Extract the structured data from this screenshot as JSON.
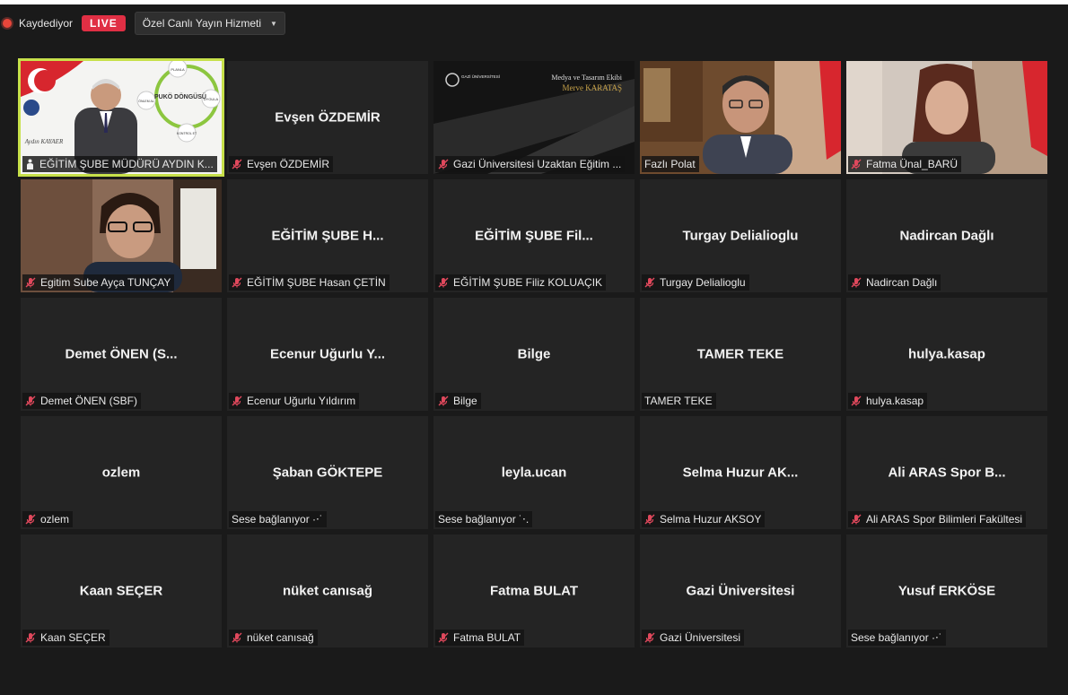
{
  "recording": {
    "label": "Kaydediyor",
    "live": "LIVE",
    "stream_service": "Özel Canlı Yayın Hizmeti"
  },
  "colors": {
    "active_border": "#c7e04a",
    "live": "#e02f44",
    "muted_mic": "#e0485c"
  },
  "tiles": [
    {
      "name": "",
      "label": "EĞİTİM ŞUBE MÜDÜRÜ AYDIN K...",
      "icon": "hand-icon",
      "active": true,
      "video": "presentation",
      "slide": {
        "center": "PUKÖ DÖNGÜSÜ",
        "planla": "PLANLA",
        "uygula": "UYGULA",
        "kontrol": "KONTROL ET",
        "onlem": "ÖNLEM AL",
        "signature": "Aydın KAYAER"
      }
    },
    {
      "name": "Evşen ÖZDEMİR",
      "label": "Evşen ÖZDEMİR",
      "icon": "mic-muted-icon"
    },
    {
      "name": "",
      "label": "Gazi Üniversitesi Uzaktan Eğitim ...",
      "icon": "mic-muted-icon",
      "video": "banner",
      "banner": {
        "org": "GAZİ ÜNİVERSİTESİ",
        "line1": "Medya ve Tasarım Ekibi",
        "line2": "Merve KARATAŞ"
      }
    },
    {
      "name": "",
      "label": "Fazlı Polat",
      "icon": "",
      "video": "man"
    },
    {
      "name": "",
      "label": "Fatma Ünal_BARÜ",
      "icon": "mic-muted-icon",
      "video": "woman"
    },
    {
      "name": "",
      "label": "Egitim Sube Ayça TUNÇAY",
      "icon": "mic-muted-icon",
      "video": "woman2"
    },
    {
      "name": "EĞİTİM ŞUBE H...",
      "label": "EĞİTİM ŞUBE Hasan ÇETİN",
      "icon": "mic-muted-icon"
    },
    {
      "name": "EĞİTİM ŞUBE Fil...",
      "label": "EĞİTİM ŞUBE Filiz KOLUAÇIK",
      "icon": "mic-muted-icon"
    },
    {
      "name": "Turgay Delialioglu",
      "label": "Turgay Delialioglu",
      "icon": "mic-muted-icon"
    },
    {
      "name": "Nadircan Dağlı",
      "label": "Nadircan Dağlı",
      "icon": "mic-muted-icon"
    },
    {
      "name": "Demet ÖNEN (S...",
      "label": "Demet ÖNEN (SBF)",
      "icon": "mic-muted-icon"
    },
    {
      "name": "Ecenur Uğurlu Y...",
      "label": "Ecenur Uğurlu Yıldırım",
      "icon": "mic-muted-icon"
    },
    {
      "name": "Bilge",
      "label": "Bilge",
      "icon": "mic-muted-icon"
    },
    {
      "name": "TAMER TEKE",
      "label": "TAMER TEKE",
      "icon": ""
    },
    {
      "name": "hulya.kasap",
      "label": "hulya.kasap",
      "icon": "mic-muted-icon"
    },
    {
      "name": "ozlem",
      "label": "ozlem",
      "icon": "mic-muted-icon"
    },
    {
      "name": "Şaban GÖKTEPE",
      "label": "Sese bağlanıyor ·⋅˙",
      "icon": ""
    },
    {
      "name": "leyla.ucan",
      "label": "Sese bağlanıyor ˙⋅.",
      "icon": ""
    },
    {
      "name": "Selma Huzur AK...",
      "label": "Selma Huzur AKSOY",
      "icon": "mic-muted-icon"
    },
    {
      "name": "Ali ARAS Spor B...",
      "label": "Ali ARAS Spor Bilimleri Fakültesi",
      "icon": "mic-muted-icon"
    },
    {
      "name": "Kaan SEÇER",
      "label": "Kaan SEÇER",
      "icon": "mic-muted-icon"
    },
    {
      "name": "nüket canısağ",
      "label": "nüket canısağ",
      "icon": "mic-muted-icon"
    },
    {
      "name": "Fatma BULAT",
      "label": "Fatma BULAT",
      "icon": "mic-muted-icon"
    },
    {
      "name": "Gazi Üniversitesi",
      "label": "Gazi Üniversitesi",
      "icon": "mic-muted-icon"
    },
    {
      "name": "Yusuf ERKÖSE",
      "label": "Sese bağlanıyor ·⋅˙",
      "icon": ""
    }
  ]
}
